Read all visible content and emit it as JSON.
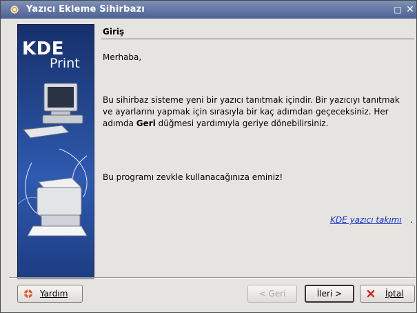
{
  "window": {
    "title": "Yazıcı Ekleme Sihirbazı",
    "maximize_label": "□",
    "close_label": "✕"
  },
  "side_panel": {
    "logo_kde": "KDE",
    "logo_print": "Print"
  },
  "page": {
    "section_title": "Giriş",
    "greeting": "Merhaba,",
    "intro_part1": "Bu sihirbaz sisteme yeni bir yazıcı tanıtmak içindir. Bir yazıcıyı tanıtmak ve ayarlarını yapmak için sırasıyla bir kaç adımdan geçeceksiniz. Her adımda ",
    "intro_bold": "Geri",
    "intro_part2": " düğmesi yardımıyla geriye dönebilirsiniz.",
    "closing": "Bu programı zevkle kullanacağınıza eminiz!",
    "team_link": "KDE yazıcı takımı",
    "team_link_suffix": "."
  },
  "buttons": {
    "help": "Yardım",
    "back": "< Geri",
    "next": "İleri >",
    "cancel": "İptal"
  },
  "colors": {
    "titlebar": "#5a6d9c",
    "link": "#1a36c9",
    "side_panel": "#244891"
  },
  "icons": {
    "app": "kde-gear-icon",
    "help": "help-lifebuoy-icon",
    "cancel": "cancel-x-icon"
  }
}
